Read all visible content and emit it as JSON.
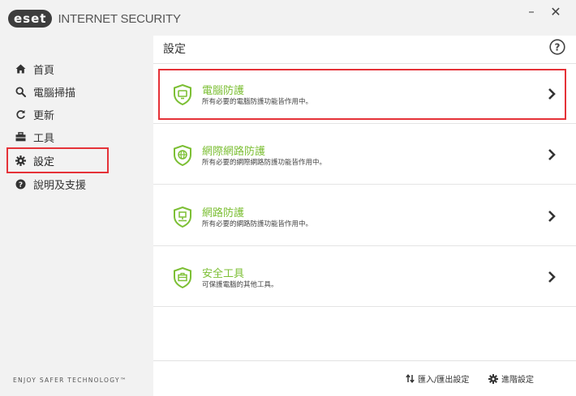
{
  "app": {
    "logo_text": "eset",
    "product_name": "INTERNET SECURITY",
    "tagline": "ENJOY SAFER TECHNOLOGY™"
  },
  "window_controls": {
    "minimize": "–",
    "close": "✕"
  },
  "sidebar": {
    "items": [
      {
        "label": "首頁",
        "icon": "home-icon",
        "active": false
      },
      {
        "label": "電腦掃描",
        "icon": "search-icon",
        "active": false
      },
      {
        "label": "更新",
        "icon": "refresh-icon",
        "active": false
      },
      {
        "label": "工具",
        "icon": "toolbox-icon",
        "active": false
      },
      {
        "label": "設定",
        "icon": "gear-icon",
        "active": true
      },
      {
        "label": "說明及支援",
        "icon": "question-circle-icon",
        "active": false
      }
    ]
  },
  "main": {
    "title": "設定",
    "help_icon": "question-circle-icon",
    "cards": [
      {
        "title": "電腦防護",
        "description": "所有必要的電腦防護功能皆作用中。",
        "icon": "shield-monitor-icon",
        "highlighted": true
      },
      {
        "title": "網際網路防護",
        "description": "所有必要的網際網路防護功能皆作用中。",
        "icon": "shield-globe-icon",
        "highlighted": false
      },
      {
        "title": "網路防護",
        "description": "所有必要的網路防護功能皆作用中。",
        "icon": "shield-network-icon",
        "highlighted": false
      },
      {
        "title": "安全工具",
        "description": "可保護電腦的其他工具。",
        "icon": "shield-toolbox-icon",
        "highlighted": false
      }
    ]
  },
  "footer": {
    "import_export_label": "匯入/匯出設定",
    "advanced_label": "進階設定"
  },
  "colors": {
    "accent_green": "#7cbf34",
    "highlight_red": "#e53238",
    "sidebar_bg": "#f2f2f2"
  }
}
